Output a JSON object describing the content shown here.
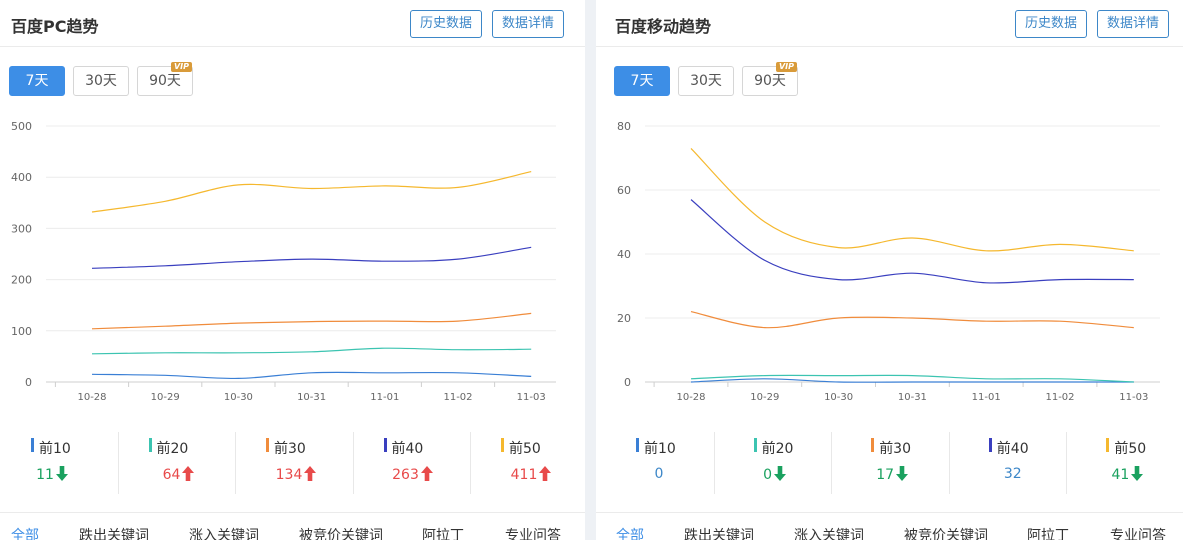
{
  "panels": [
    {
      "title": "百度PC趋势",
      "buttons": {
        "history": "历史数据",
        "detail": "数据详情"
      },
      "ranges": [
        {
          "label": "7天",
          "active": true
        },
        {
          "label": "30天"
        },
        {
          "label": "90天",
          "badge": "VIP"
        }
      ],
      "tabs": [
        "全部",
        "跌出关键词",
        "涨入关键词",
        "被竞价关键词",
        "阿拉丁",
        "专业问答"
      ],
      "stats": [
        {
          "label": "前10",
          "value": "11",
          "trend": "down",
          "color": "#3a7fd5"
        },
        {
          "label": "前20",
          "value": "64",
          "trend": "up",
          "color": "#3cc4b1"
        },
        {
          "label": "前30",
          "value": "134",
          "trend": "up",
          "color": "#f08c3c"
        },
        {
          "label": "前40",
          "value": "263",
          "trend": "up",
          "color": "#3a3fbf"
        },
        {
          "label": "前50",
          "value": "411",
          "trend": "up",
          "color": "#f5b82e"
        }
      ],
      "chart_data": {
        "type": "line",
        "categories": [
          "10-28",
          "10-29",
          "10-30",
          "10-31",
          "11-01",
          "11-02",
          "11-03"
        ],
        "ylim": [
          0,
          500
        ],
        "yticks": [
          0,
          100,
          200,
          300,
          400,
          500
        ],
        "series": [
          {
            "name": "前10",
            "color": "#3a7fd5",
            "values": [
              15,
              13,
              7,
              18,
              18,
              18,
              11
            ]
          },
          {
            "name": "前20",
            "color": "#3cc4b1",
            "values": [
              55,
              57,
              57,
              59,
              66,
              63,
              64
            ]
          },
          {
            "name": "前30",
            "color": "#f08c3c",
            "values": [
              104,
              109,
              115,
              118,
              119,
              119,
              134
            ]
          },
          {
            "name": "前40",
            "color": "#3a3fbf",
            "values": [
              222,
              227,
              235,
              240,
              236,
              240,
              263
            ]
          },
          {
            "name": "前50",
            "color": "#f5b82e",
            "values": [
              332,
              353,
              385,
              378,
              383,
              380,
              411
            ]
          }
        ]
      }
    },
    {
      "title": "百度移动趋势",
      "buttons": {
        "history": "历史数据",
        "detail": "数据详情"
      },
      "ranges": [
        {
          "label": "7天",
          "active": true
        },
        {
          "label": "30天"
        },
        {
          "label": "90天",
          "badge": "VIP"
        }
      ],
      "tabs": [
        "全部",
        "跌出关键词",
        "涨入关键词",
        "被竞价关键词",
        "阿拉丁",
        "专业问答"
      ],
      "stats": [
        {
          "label": "前10",
          "value": "0",
          "trend": "none",
          "color": "#3a7fd5"
        },
        {
          "label": "前20",
          "value": "0",
          "trend": "down",
          "color": "#3cc4b1"
        },
        {
          "label": "前30",
          "value": "17",
          "trend": "down",
          "color": "#f08c3c"
        },
        {
          "label": "前40",
          "value": "32",
          "trend": "none",
          "color": "#3a3fbf"
        },
        {
          "label": "前50",
          "value": "41",
          "trend": "down",
          "color": "#f5b82e"
        }
      ],
      "chart_data": {
        "type": "line",
        "categories": [
          "10-28",
          "10-29",
          "10-30",
          "10-31",
          "11-01",
          "11-02",
          "11-03"
        ],
        "ylim": [
          0,
          80
        ],
        "yticks": [
          0,
          20,
          40,
          60,
          80
        ],
        "series": [
          {
            "name": "前10",
            "color": "#3a7fd5",
            "values": [
              0,
              1,
              0,
              0,
              0,
              0,
              0
            ]
          },
          {
            "name": "前20",
            "color": "#3cc4b1",
            "values": [
              1,
              2,
              2,
              2,
              1,
              1,
              0
            ]
          },
          {
            "name": "前30",
            "color": "#f08c3c",
            "values": [
              22,
              17,
              20,
              20,
              19,
              19,
              17
            ]
          },
          {
            "name": "前40",
            "color": "#3a3fbf",
            "values": [
              57,
              38,
              32,
              34,
              31,
              32,
              32
            ]
          },
          {
            "name": "前50",
            "color": "#f5b82e",
            "values": [
              73,
              50,
              42,
              45,
              41,
              43,
              41
            ]
          }
        ]
      }
    }
  ],
  "colors": {
    "accent": "#3d8ee6",
    "up": "#e84a4a",
    "down": "#1aa15f",
    "neutral": "#3d87c8"
  }
}
